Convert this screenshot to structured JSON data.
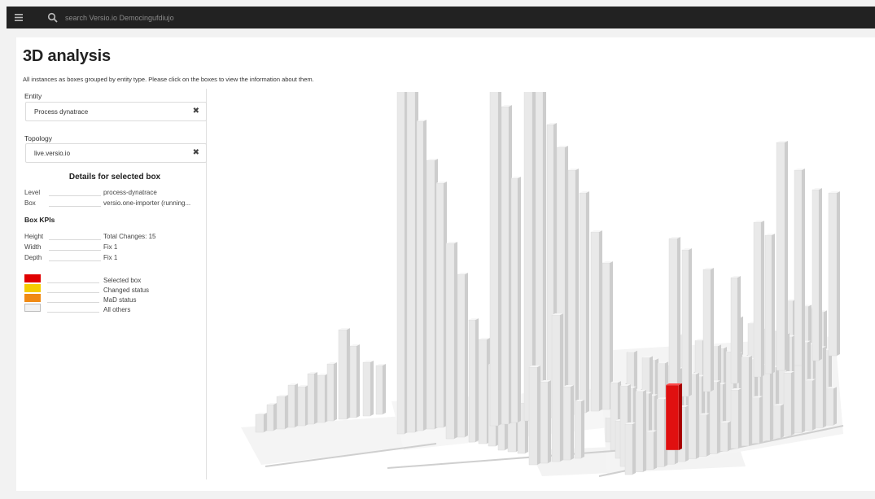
{
  "topbar": {
    "search_placeholder": "search Versio.io Democingufdiujo",
    "menu_icon": "hamburger-icon",
    "search_icon": "search-icon"
  },
  "page": {
    "title": "3D analysis",
    "description": "All instances as boxes grouped by entity type. Please click on the boxes to view the information about them."
  },
  "filters": {
    "entity_label": "Entity",
    "entity_value": "Process dynatrace",
    "topology_label": "Topology",
    "topology_value": "live.versio.io"
  },
  "details": {
    "title": "Details for selected box",
    "rows": [
      {
        "key": "Level",
        "value": "process-dynatrace"
      },
      {
        "key": "Box",
        "value": "versio.one-importer (running..."
      }
    ],
    "kpis_title": "Box KPIs",
    "kpis": [
      {
        "key": "Height",
        "value": "Total Changes: 15"
      },
      {
        "key": "Width",
        "value": "Fix 1"
      },
      {
        "key": "Depth",
        "value": "Fix 1"
      }
    ]
  },
  "legend": [
    {
      "label": "Selected box",
      "color": "#e00000"
    },
    {
      "label": "Changed status",
      "color": "#f5cc00"
    },
    {
      "label": "MaD status",
      "color": "#f08a14"
    },
    {
      "label": "All others",
      "color": "#f2f2f2"
    }
  ],
  "scene": {
    "box_color": "#e6e6e6",
    "selected_color": "#e01010"
  }
}
